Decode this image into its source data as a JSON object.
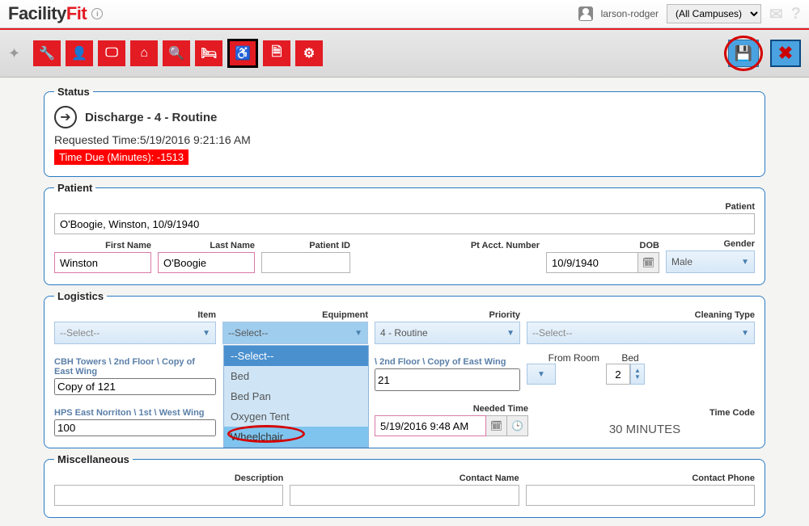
{
  "header": {
    "logo_a": "Facility",
    "logo_b": "Fit",
    "user": "larson-rodger",
    "campus": "(All Campuses)"
  },
  "toolbar": {
    "icons": {
      "wrench": "🔧",
      "user": "👤",
      "monitor": "🖵",
      "home": "⌂",
      "search": "🔍",
      "bed": "🛏",
      "wheelchair": "♿",
      "doc": "🗎",
      "gear": "⚙"
    }
  },
  "status": {
    "title": "Discharge - 4 - Routine",
    "requested": "Requested Time:5/19/2016 9:21:16 AM",
    "due": "Time Due (Minutes): -1513"
  },
  "patient": {
    "label_patient": "Patient",
    "full": "O'Boogie, Winston, 10/9/1940",
    "lbl_first": "First Name",
    "first": "Winston",
    "lbl_last": "Last Name",
    "last": "O'Boogie",
    "lbl_pid": "Patient ID",
    "lbl_acct": "Pt Acct. Number",
    "lbl_dob": "DOB",
    "dob": "10/9/1940",
    "lbl_gender": "Gender",
    "gender": "Male"
  },
  "logistics": {
    "lbl_item": "Item",
    "item": "--Select--",
    "lbl_equip": "Equipment",
    "equip": "--Select--",
    "equip_opts": {
      "o0": "--Select--",
      "o1": "Bed",
      "o2": "Bed Pan",
      "o3": "Oxygen Tent",
      "o4": "Wheelchair"
    },
    "lbl_priority": "Priority",
    "priority": "4 - Routine",
    "lbl_clean": "Cleaning Type",
    "clean": "--Select--",
    "crumb1": "CBH Towers \\ 2nd Floor \\ Copy of East Wing",
    "room1": "Copy of 121",
    "crumb1b": "\\ 2nd Floor \\ Copy of East Wing",
    "lbl_fromroom": "From Room",
    "fromroom": "21",
    "lbl_bed": "Bed",
    "bed": "2",
    "crumb2": "HPS East Norriton \\ 1st \\ West Wing",
    "room2": "100",
    "lbl_needed": "Needed Time",
    "needed": "5/19/2016 9:48 AM",
    "lbl_timecode": "Time Code",
    "timecode": "30 MINUTES"
  },
  "misc": {
    "lbl_desc": "Description",
    "lbl_contact": "Contact Name",
    "lbl_phone": "Contact Phone"
  }
}
